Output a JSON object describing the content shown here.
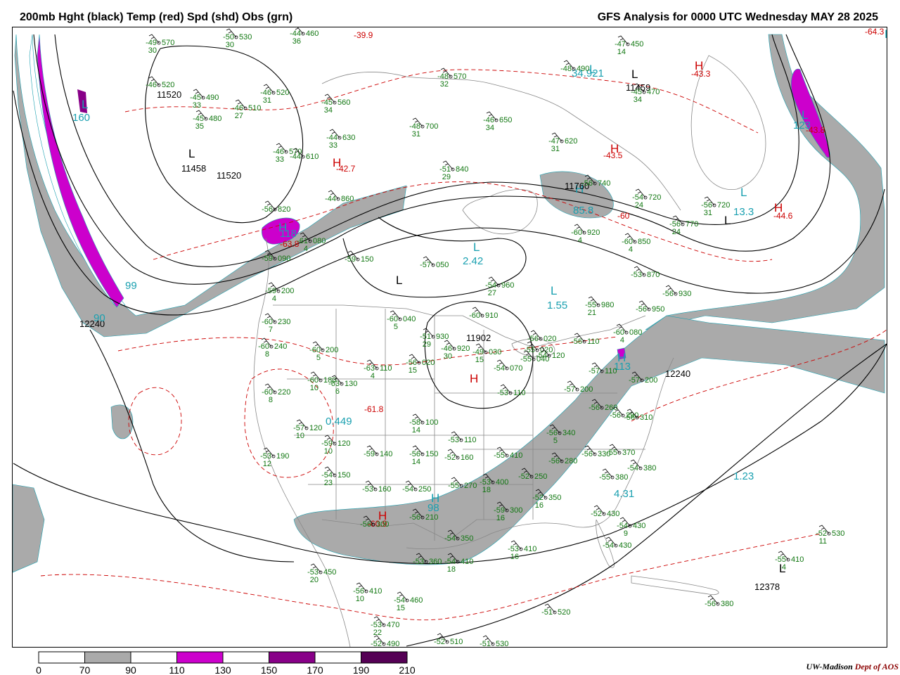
{
  "header": {
    "left_title": "200mb Hght (black) Temp (red) Spd (shd) Obs (grn)",
    "right_title": "GFS Analysis for 0000 UTC Wednesday  MAY 28 2025"
  },
  "colors": {
    "height": "#000000",
    "temperature": "#cc0000",
    "observations": "#117711",
    "speed_label": "#1aa0b0",
    "borders": "#888888",
    "shade_70_90": "#aaaaaa",
    "shade_110_130": "#cc00cc",
    "shade_150_170": "#880088",
    "shade_190_210": "#550055"
  },
  "colorbar": {
    "ticks": [
      "0",
      "70",
      "90",
      "110",
      "130",
      "150",
      "170",
      "190",
      "210"
    ],
    "fills": [
      "#ffffff",
      "#aaaaaa",
      "#ffffff",
      "#cc00cc",
      "#ffffff",
      "#880088",
      "#ffffff",
      "#550055"
    ]
  },
  "credit": {
    "org": "UW-Madison",
    "dept": "Dept of AOS"
  },
  "map": {
    "height_labels": [
      {
        "text": "11520"
      },
      {
        "text": "11458"
      },
      {
        "text": "11520"
      },
      {
        "text": "11459"
      },
      {
        "text": "11760"
      },
      {
        "text": "11902"
      },
      {
        "text": "12240"
      },
      {
        "text": "12240"
      },
      {
        "text": "12378"
      }
    ],
    "high_low_markers": [
      {
        "symbol": "L",
        "color": "black"
      },
      {
        "symbol": "L",
        "color": "black"
      },
      {
        "symbol": "L",
        "color": "black"
      },
      {
        "symbol": "L",
        "color": "black"
      },
      {
        "symbol": "L",
        "color": "black"
      },
      {
        "symbol": "H",
        "color": "red"
      },
      {
        "symbol": "H",
        "color": "red"
      },
      {
        "symbol": "H",
        "color": "red"
      },
      {
        "symbol": "H",
        "color": "red"
      },
      {
        "symbol": "H",
        "color": "red"
      },
      {
        "symbol": "H",
        "color": "red"
      },
      {
        "symbol": "L",
        "color": "cyan"
      },
      {
        "symbol": "L",
        "color": "cyan"
      },
      {
        "symbol": "L",
        "color": "cyan"
      },
      {
        "symbol": "L",
        "color": "cyan"
      },
      {
        "symbol": "L",
        "color": "cyan"
      },
      {
        "symbol": "L",
        "color": "cyan"
      },
      {
        "symbol": "H",
        "color": "cyan"
      },
      {
        "symbol": "H",
        "color": "cyan"
      },
      {
        "symbol": "H",
        "color": "cyan"
      },
      {
        "symbol": "H",
        "color": "cyan"
      },
      {
        "symbol": "H",
        "color": "cyan"
      }
    ],
    "temperature_labels": [
      {
        "text": "-39.9"
      },
      {
        "text": "-42.7"
      },
      {
        "text": "-43.3"
      },
      {
        "text": "-43.5"
      },
      {
        "text": "-43.8"
      },
      {
        "text": "-44.6"
      },
      {
        "text": "-60"
      },
      {
        "text": "-63.8"
      },
      {
        "text": "-64.3"
      },
      {
        "text": "-61.8"
      },
      {
        "text": "-60.9"
      }
    ],
    "speed_labels": [
      {
        "text": "160"
      },
      {
        "text": "123"
      },
      {
        "text": "118"
      },
      {
        "text": "99"
      },
      {
        "text": "90"
      },
      {
        "text": "85.8"
      },
      {
        "text": "34.921"
      },
      {
        "text": "2.42"
      },
      {
        "text": "1.55"
      },
      {
        "text": "0.449"
      },
      {
        "text": "13.3"
      },
      {
        "text": "1.23"
      },
      {
        "text": "113"
      },
      {
        "text": "4.31"
      },
      {
        "text": "98"
      }
    ],
    "observations": [
      {
        "t": "-49",
        "h": "570",
        "d": "30"
      },
      {
        "t": "-50",
        "h": "530",
        "d": "30"
      },
      {
        "t": "-44",
        "h": "460",
        "d": "36"
      },
      {
        "t": "-46",
        "h": "520",
        "d": ""
      },
      {
        "t": "-45",
        "h": "490",
        "d": "33"
      },
      {
        "t": "-46",
        "h": "510",
        "d": "27"
      },
      {
        "t": "-45",
        "h": "480",
        "d": "35"
      },
      {
        "t": "-46",
        "h": "520",
        "d": "31"
      },
      {
        "t": "-45",
        "h": "560",
        "d": "34"
      },
      {
        "t": "-48",
        "h": "570",
        "d": "32"
      },
      {
        "t": "-48",
        "h": "700",
        "d": "31"
      },
      {
        "t": "-48",
        "h": "490",
        "d": ""
      },
      {
        "t": "-47",
        "h": "450",
        "d": "14"
      },
      {
        "t": "-45",
        "h": "470",
        "d": "34"
      },
      {
        "t": "-46",
        "h": "650",
        "d": "34"
      },
      {
        "t": "-47",
        "h": "620",
        "d": "31"
      },
      {
        "t": "-44",
        "h": "630",
        "d": "33"
      },
      {
        "t": "-46",
        "h": "570",
        "d": "33"
      },
      {
        "t": "-44",
        "h": "610",
        "d": ""
      },
      {
        "t": "-51",
        "h": "840",
        "d": "29"
      },
      {
        "t": "-44",
        "h": "860",
        "d": ""
      },
      {
        "t": "-56",
        "h": "820",
        "d": ""
      },
      {
        "t": "-61",
        "h": "080",
        "d": "4"
      },
      {
        "t": "-59",
        "h": "090",
        "d": ""
      },
      {
        "t": "-59",
        "h": "150",
        "d": ""
      },
      {
        "t": "-57",
        "h": "050",
        "d": ""
      },
      {
        "t": "-59",
        "h": "200",
        "d": "4"
      },
      {
        "t": "-60",
        "h": "230",
        "d": "7"
      },
      {
        "t": "-60",
        "h": "240",
        "d": "8"
      },
      {
        "t": "-60",
        "h": "200",
        "d": "5"
      },
      {
        "t": "-60",
        "h": "040",
        "d": "5"
      },
      {
        "t": "-63",
        "h": "110",
        "d": "4"
      },
      {
        "t": "-56",
        "h": "020",
        "d": "15"
      },
      {
        "t": "-51",
        "h": "930",
        "d": "29"
      },
      {
        "t": "-46",
        "h": "920",
        "d": "30"
      },
      {
        "t": "-49",
        "h": "030",
        "d": "15"
      },
      {
        "t": "-55",
        "h": "020",
        "d": ""
      },
      {
        "t": "-56",
        "h": "020",
        "d": ""
      },
      {
        "t": "-54",
        "h": "960",
        "d": "27"
      },
      {
        "t": "-60",
        "h": "910",
        "d": ""
      },
      {
        "t": "-55",
        "h": "980",
        "d": "21"
      },
      {
        "t": "-56",
        "h": "930",
        "d": ""
      },
      {
        "t": "-56",
        "h": "950",
        "d": ""
      },
      {
        "t": "-60",
        "h": "080",
        "d": "4"
      },
      {
        "t": "-54",
        "h": "720",
        "d": "24"
      },
      {
        "t": "-56",
        "h": "720",
        "d": "31"
      },
      {
        "t": "-56",
        "h": "770",
        "d": "24"
      },
      {
        "t": "-60",
        "h": "850",
        "d": "4"
      },
      {
        "t": "-53",
        "h": "870",
        "d": ""
      },
      {
        "t": "-60",
        "h": "920",
        "d": "4"
      },
      {
        "t": "-56",
        "h": "740",
        "d": ""
      },
      {
        "t": "-60",
        "h": "180",
        "d": "10"
      },
      {
        "t": "-60",
        "h": "220",
        "d": "8"
      },
      {
        "t": "-63",
        "h": "130",
        "d": "6"
      },
      {
        "t": "-57",
        "h": "120",
        "d": "10"
      },
      {
        "t": "-59",
        "h": "120",
        "d": "10"
      },
      {
        "t": "-59",
        "h": "140",
        "d": ""
      },
      {
        "t": "-53",
        "h": "190",
        "d": "12"
      },
      {
        "t": "-54",
        "h": "150",
        "d": "23"
      },
      {
        "t": "-53",
        "h": "160",
        "d": ""
      },
      {
        "t": "-56",
        "h": "150",
        "d": "14"
      },
      {
        "t": "-58",
        "h": "100",
        "d": "14"
      },
      {
        "t": "-53",
        "h": "110",
        "d": ""
      },
      {
        "t": "-52",
        "h": "160",
        "d": ""
      },
      {
        "t": "-54",
        "h": "070",
        "d": ""
      },
      {
        "t": "-53",
        "h": "110",
        "d": ""
      },
      {
        "t": "-55",
        "h": "040",
        "d": ""
      },
      {
        "t": "-54",
        "h": "120",
        "d": ""
      },
      {
        "t": "-56",
        "h": "110",
        "d": ""
      },
      {
        "t": "-57",
        "h": "110",
        "d": ""
      },
      {
        "t": "-57",
        "h": "200",
        "d": ""
      },
      {
        "t": "-57",
        "h": "200",
        "d": ""
      },
      {
        "t": "-56",
        "h": "260",
        "d": ""
      },
      {
        "t": "-56",
        "h": "290",
        "d": ""
      },
      {
        "t": "-56",
        "h": "310",
        "d": ""
      },
      {
        "t": "-56",
        "h": "340",
        "d": "5"
      },
      {
        "t": "-56",
        "h": "280",
        "d": ""
      },
      {
        "t": "-56",
        "h": "330",
        "d": ""
      },
      {
        "t": "-55",
        "h": "370",
        "d": ""
      },
      {
        "t": "-55",
        "h": "380",
        "d": ""
      },
      {
        "t": "-55",
        "h": "410",
        "d": ""
      },
      {
        "t": "-52",
        "h": "250",
        "d": ""
      },
      {
        "t": "-52",
        "h": "350",
        "d": "16"
      },
      {
        "t": "-53",
        "h": "400",
        "d": "18"
      },
      {
        "t": "-55",
        "h": "270",
        "d": ""
      },
      {
        "t": "-54",
        "h": "250",
        "d": ""
      },
      {
        "t": "-56",
        "h": "210",
        "d": ""
      },
      {
        "t": "-56",
        "h": "300",
        "d": ""
      },
      {
        "t": "-59",
        "h": "300",
        "d": "16"
      },
      {
        "t": "-54",
        "h": "350",
        "d": ""
      },
      {
        "t": "-53",
        "h": "360",
        "d": ""
      },
      {
        "t": "-54",
        "h": "410",
        "d": "18"
      },
      {
        "t": "-52",
        "h": "430",
        "d": ""
      },
      {
        "t": "-54",
        "h": "430",
        "d": "9"
      },
      {
        "t": "-54",
        "h": "430",
        "d": ""
      },
      {
        "t": "-53",
        "h": "450",
        "d": "20"
      },
      {
        "t": "-56",
        "h": "410",
        "d": "10"
      },
      {
        "t": "-54",
        "h": "460",
        "d": "15"
      },
      {
        "t": "-53",
        "h": "470",
        "d": "22"
      },
      {
        "t": "-52",
        "h": "490",
        "d": ""
      },
      {
        "t": "-52",
        "h": "510",
        "d": ""
      },
      {
        "t": "-51",
        "h": "530",
        "d": ""
      },
      {
        "t": "-51",
        "h": "520",
        "d": ""
      },
      {
        "t": "-52",
        "h": "530",
        "d": "11"
      },
      {
        "t": "-55",
        "h": "410",
        "d": "4"
      },
      {
        "t": "-56",
        "h": "380",
        "d": ""
      },
      {
        "t": "-53",
        "h": "410",
        "d": "16"
      },
      {
        "t": "-54",
        "h": "380",
        "d": ""
      },
      {
        "t": "-53",
        "h": "560",
        "d": ""
      }
    ]
  }
}
